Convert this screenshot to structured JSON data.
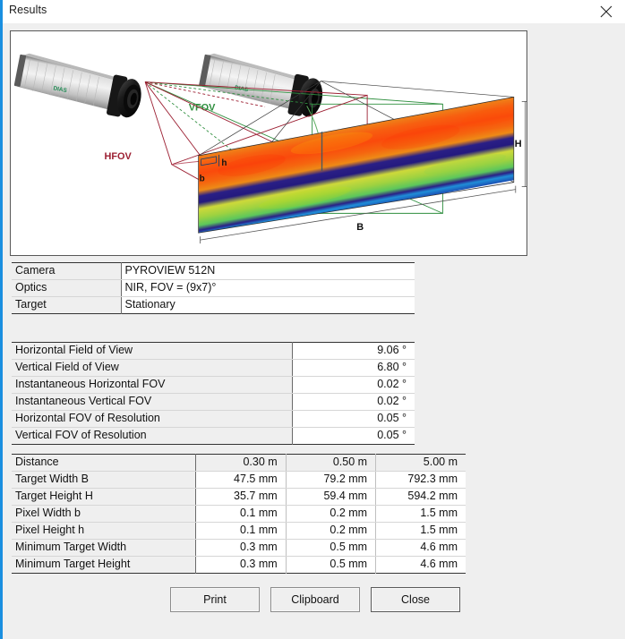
{
  "window": {
    "title": "Results",
    "close_icon": "close-icon"
  },
  "diagram": {
    "labels": {
      "vfov": "VFOV",
      "hfov": "HFOV",
      "target_width": "B",
      "target_height": "H",
      "pixel_width": "b",
      "pixel_height": "h"
    },
    "colors": {
      "vfov": "#2f8f3f",
      "hfov": "#9c1f32",
      "outline": "#333333"
    }
  },
  "table_camera": {
    "rows": [
      {
        "label": "Camera",
        "value": "PYROVIEW 512N"
      },
      {
        "label": "Optics",
        "value": "NIR, FOV = (9x7)°"
      },
      {
        "label": "Target",
        "value": "Stationary"
      }
    ]
  },
  "table_fov": {
    "rows": [
      {
        "label": "Horizontal Field of View",
        "value": "9.06 °"
      },
      {
        "label": "Vertical Field of View",
        "value": "6.80 °"
      },
      {
        "label": "Instantaneous Horizontal FOV",
        "value": "0.02 °"
      },
      {
        "label": "Instantaneous Vertical FOV",
        "value": "0.02 °"
      },
      {
        "label": "Horizontal FOV of Resolution",
        "value": "0.05 °"
      },
      {
        "label": "Vertical FOV of Resolution",
        "value": "0.05 °"
      }
    ]
  },
  "table_distance": {
    "header": {
      "label": "Distance",
      "c1": "0.30 m",
      "c2": "0.50 m",
      "c3": "5.00 m"
    },
    "rows": [
      {
        "label": "Target Width B",
        "c1": "47.5 mm",
        "c2": "79.2 mm",
        "c3": "792.3 mm"
      },
      {
        "label": "Target Height H",
        "c1": "35.7 mm",
        "c2": "59.4 mm",
        "c3": "594.2 mm"
      },
      {
        "label": "Pixel Width b",
        "c1": "0.1 mm",
        "c2": "0.2 mm",
        "c3": "1.5 mm"
      },
      {
        "label": "Pixel Height h",
        "c1": "0.1 mm",
        "c2": "0.2 mm",
        "c3": "1.5 mm"
      },
      {
        "label": "Minimum Target Width",
        "c1": "0.3 mm",
        "c2": "0.5 mm",
        "c3": "4.6 mm"
      },
      {
        "label": "Minimum Target Height",
        "c1": "0.3 mm",
        "c2": "0.5 mm",
        "c3": "4.6 mm"
      }
    ]
  },
  "buttons": {
    "print": "Print",
    "clipboard": "Clipboard",
    "close": "Close"
  }
}
